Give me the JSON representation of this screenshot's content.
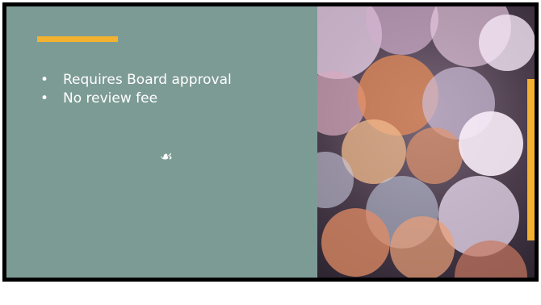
{
  "slide": {
    "bullets": [
      {
        "marker": "•",
        "text": "Requires Board approval"
      },
      {
        "marker": "•",
        "text": "No review fee"
      }
    ],
    "flourish": "☙",
    "colors": {
      "panel": "#7d9b95",
      "accent": "#f2b22f",
      "text": "#ffffff"
    },
    "image": {
      "icon": "bokeh-lights-photo"
    }
  }
}
